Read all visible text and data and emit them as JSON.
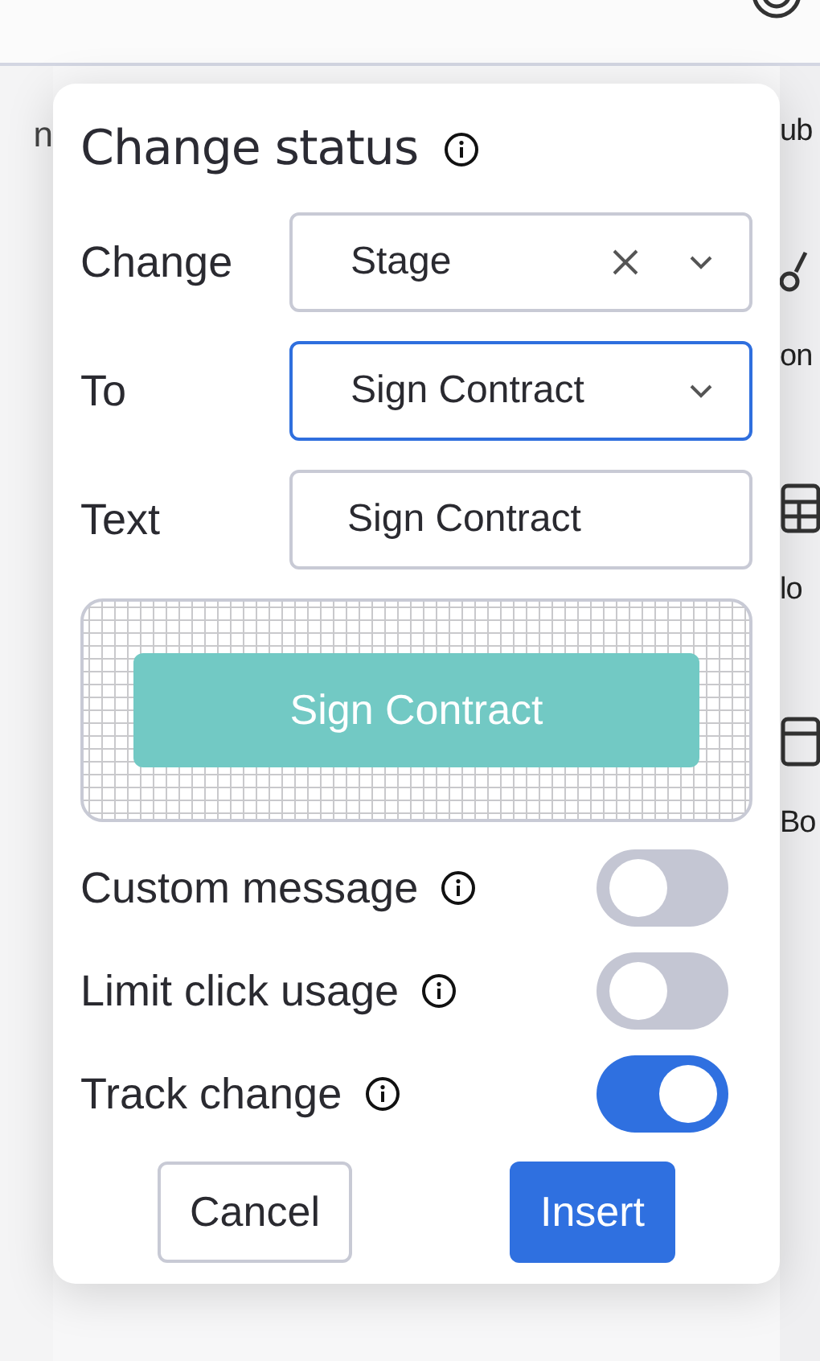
{
  "background": {
    "left_fragments": [
      {
        "text": "n"
      }
    ],
    "right_fragments": [
      {
        "text": "ub",
        "kind": "text"
      },
      {
        "text": "on",
        "kind": "network"
      },
      {
        "text": "lo",
        "kind": "table"
      },
      {
        "text": "Bo",
        "kind": "layout"
      }
    ]
  },
  "dialog": {
    "title": "Change status",
    "fields": [
      {
        "label": "Change",
        "value": "Stage",
        "kind": "select",
        "clearable": true,
        "focused": false
      },
      {
        "label": "To",
        "value": "Sign Contract",
        "kind": "select",
        "clearable": false,
        "focused": true
      },
      {
        "label": "Text",
        "value": "Sign Contract",
        "kind": "input",
        "focused": false
      }
    ],
    "preview": {
      "button": "Sign Contract"
    },
    "toggles": [
      {
        "label": "Custom message",
        "on": false
      },
      {
        "label": "Limit click usage",
        "on": false
      },
      {
        "label": "Track change",
        "on": true
      }
    ],
    "buttons": [
      {
        "label": "Cancel",
        "kind": "secondary"
      },
      {
        "label": "Insert",
        "kind": "primary"
      }
    ]
  }
}
